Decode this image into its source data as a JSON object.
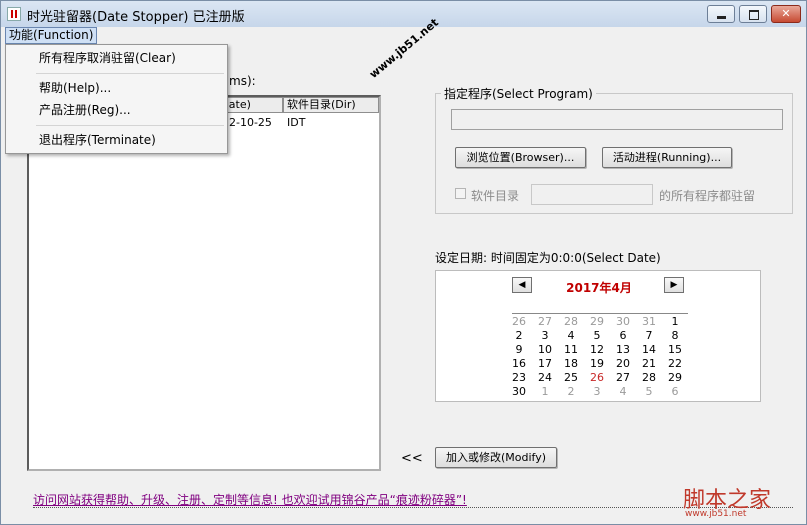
{
  "window": {
    "title": "时光驻留器(Date Stopper) 已注册版",
    "close_glyph": "✕"
  },
  "menubar": {
    "function_menu": "功能(Function)"
  },
  "dropdown": {
    "items": [
      "所有程序取消驻留(Clear)",
      "帮助(Help)...",
      "产品注册(Reg)...",
      "退出程序(Terminate)"
    ]
  },
  "left_panel": {
    "label_partial": "ms):",
    "columns": [
      "期(Date)",
      "软件目录(Dir)"
    ],
    "rows": [
      {
        "date": "2-10-25",
        "dir": "IDT"
      }
    ]
  },
  "select_program": {
    "title": "指定程序(Select Program)",
    "path_value": "",
    "browse_button": "浏览位置(Browser)...",
    "running_button": "活动进程(Running)...",
    "dir_checkbox_label": "软件目录",
    "dir_value": "",
    "dir_suffix": "的所有程序都驻留"
  },
  "date_section": {
    "label": "设定日期: 时间固定为0:0:0(Select Date)"
  },
  "calendar": {
    "title": "2017年4月",
    "prev": "◀",
    "next": "▶",
    "today": "26",
    "weeks": [
      [
        {
          "d": "26",
          "o": true
        },
        {
          "d": "27",
          "o": true
        },
        {
          "d": "28",
          "o": true
        },
        {
          "d": "29",
          "o": true
        },
        {
          "d": "30",
          "o": true
        },
        {
          "d": "31",
          "o": true
        },
        {
          "d": "1",
          "o": false
        }
      ],
      [
        {
          "d": "2",
          "o": false
        },
        {
          "d": "3",
          "o": false
        },
        {
          "d": "4",
          "o": false
        },
        {
          "d": "5",
          "o": false
        },
        {
          "d": "6",
          "o": false
        },
        {
          "d": "7",
          "o": false
        },
        {
          "d": "8",
          "o": false
        }
      ],
      [
        {
          "d": "9",
          "o": false
        },
        {
          "d": "10",
          "o": false
        },
        {
          "d": "11",
          "o": false
        },
        {
          "d": "12",
          "o": false
        },
        {
          "d": "13",
          "o": false
        },
        {
          "d": "14",
          "o": false
        },
        {
          "d": "15",
          "o": false
        }
      ],
      [
        {
          "d": "16",
          "o": false
        },
        {
          "d": "17",
          "o": false
        },
        {
          "d": "18",
          "o": false
        },
        {
          "d": "19",
          "o": false
        },
        {
          "d": "20",
          "o": false
        },
        {
          "d": "21",
          "o": false
        },
        {
          "d": "22",
          "o": false
        }
      ],
      [
        {
          "d": "23",
          "o": false
        },
        {
          "d": "24",
          "o": false
        },
        {
          "d": "25",
          "o": false
        },
        {
          "d": "26",
          "o": false
        },
        {
          "d": "27",
          "o": false
        },
        {
          "d": "28",
          "o": false
        },
        {
          "d": "29",
          "o": false
        }
      ],
      [
        {
          "d": "30",
          "o": false
        },
        {
          "d": "1",
          "o": true
        },
        {
          "d": "2",
          "o": true
        },
        {
          "d": "3",
          "o": true
        },
        {
          "d": "4",
          "o": true
        },
        {
          "d": "5",
          "o": true
        },
        {
          "d": "6",
          "o": true
        }
      ]
    ]
  },
  "actions": {
    "move_left": "<<",
    "modify_button": "加入或修改(Modify)"
  },
  "footer": {
    "link": "访问网站获得帮助、升级、注册、定制等信息! 也欢迎试用锦谷产品“痕迹粉碎器”!"
  },
  "overlay": {
    "watermark": "www.jb51.net",
    "logo": "脚本之家",
    "logo_sub": "www.jb51.net"
  },
  "colors": {
    "accent_red": "#c00000",
    "link_purple": "#800080"
  }
}
